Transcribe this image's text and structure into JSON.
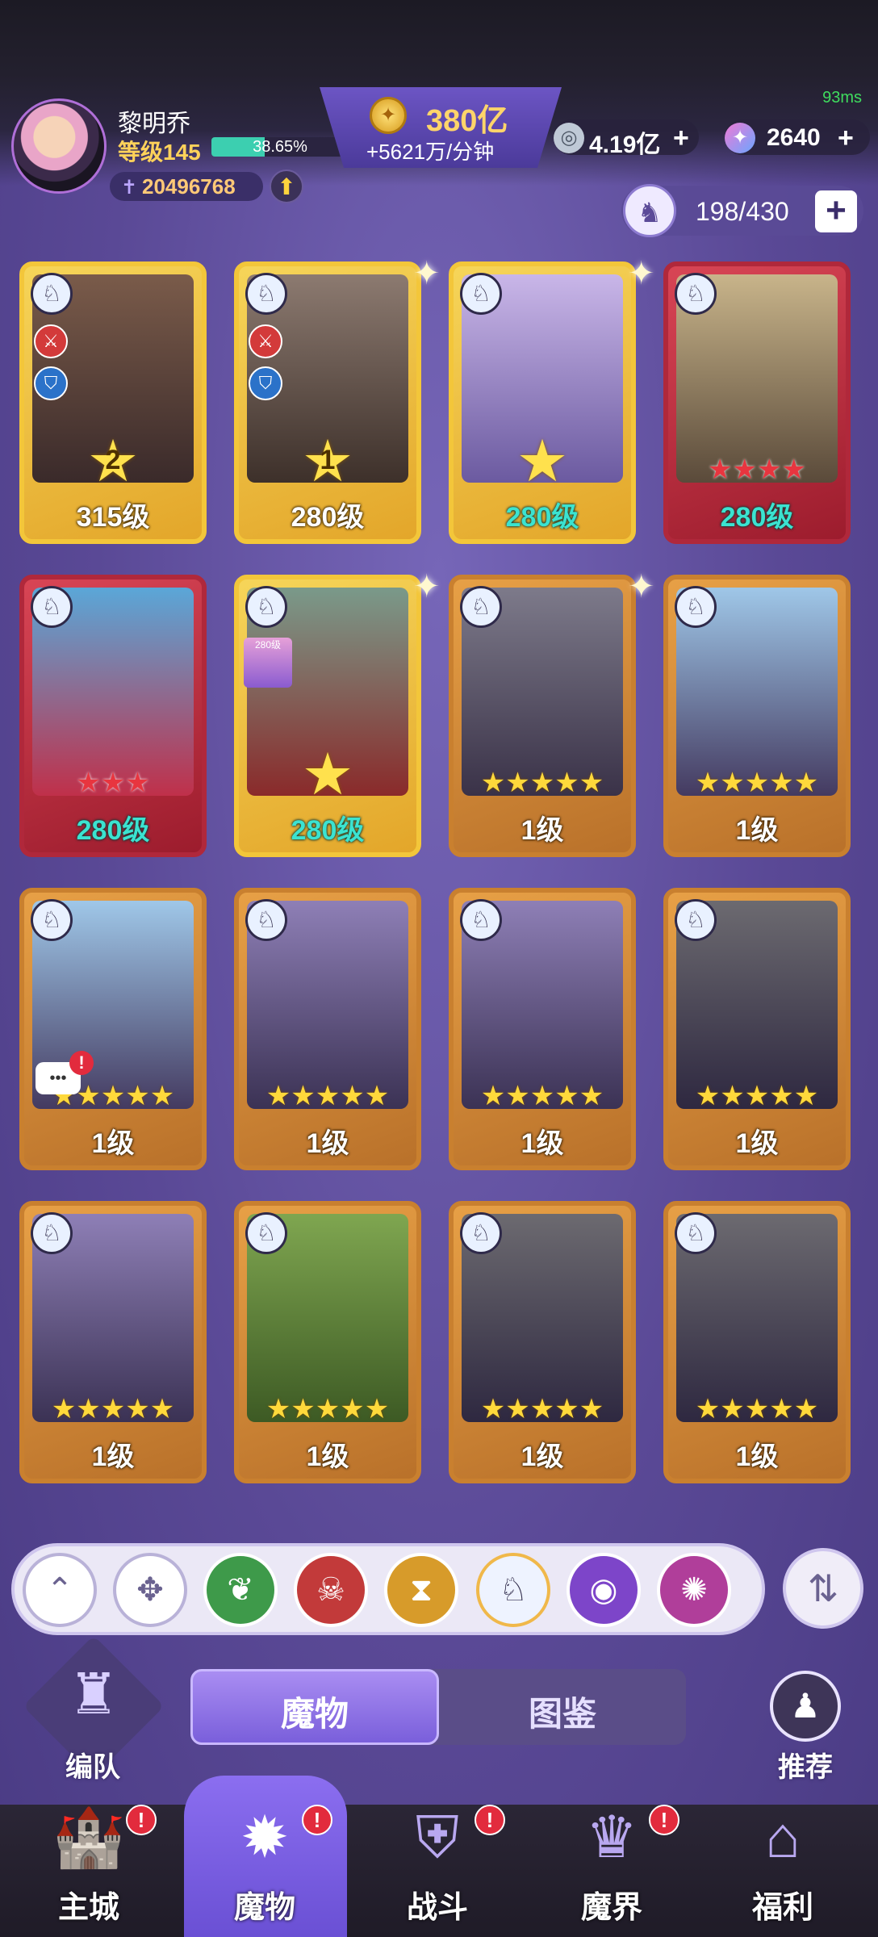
{
  "status": {
    "ping": "93ms"
  },
  "player": {
    "name": "黎明乔",
    "level": "等级145",
    "xp_percent": "38.65%",
    "xp_fraction": 0.3865,
    "power": "20496768"
  },
  "gold": {
    "amount": "380亿",
    "rate": "+5621万/分钟"
  },
  "currencies": [
    {
      "value": "4.19亿",
      "icon": "silver-coin-icon"
    },
    {
      "value": "2640",
      "icon": "star-gem-icon"
    }
  ],
  "roster": {
    "capacity": "198/430"
  },
  "cards": [
    {
      "level": "315级",
      "rank": "2",
      "frame": "gold"
    },
    {
      "level": "280级",
      "rank": "1",
      "frame": "gold"
    },
    {
      "level": "280级",
      "rank": "",
      "frame": "gold"
    },
    {
      "level": "280级",
      "stars": 4,
      "frame": "red"
    },
    {
      "level": "280级",
      "stars": 3,
      "frame": "red"
    },
    {
      "level": "280级",
      "rank": "",
      "frame": "gold",
      "mini_label": "280级"
    },
    {
      "level": "1级",
      "stars": 5,
      "frame": "orange"
    },
    {
      "level": "1级",
      "stars": 5,
      "frame": "orange"
    },
    {
      "level": "1级",
      "stars": 5,
      "frame": "orange"
    },
    {
      "level": "1级",
      "stars": 5,
      "frame": "orange"
    },
    {
      "level": "1级",
      "stars": 5,
      "frame": "orange"
    },
    {
      "level": "1级",
      "stars": 5,
      "frame": "orange"
    },
    {
      "level": "1级",
      "stars": 5,
      "frame": "orange"
    },
    {
      "level": "1级",
      "stars": 5,
      "frame": "orange"
    },
    {
      "level": "1级",
      "stars": 5,
      "frame": "orange"
    },
    {
      "level": "1级",
      "stars": 5,
      "frame": "orange"
    }
  ],
  "filters": [
    {
      "icon": "chevrons-up-icon",
      "color": "#ffffff"
    },
    {
      "icon": "all-factions-icon",
      "color": "#ffffff"
    },
    {
      "icon": "leaf-faction-icon",
      "color": "#3e9a4a"
    },
    {
      "icon": "demon-faction-icon",
      "color": "#c23a3a"
    },
    {
      "icon": "hourglass-faction-icon",
      "color": "#d79b2a"
    },
    {
      "icon": "wolf-faction-icon",
      "color": "#eef3ff",
      "selected": true
    },
    {
      "icon": "eye-faction-icon",
      "color": "#7d45c9"
    },
    {
      "icon": "swirl-faction-icon",
      "color": "#b03e9a"
    }
  ],
  "tabs": {
    "team": "编队",
    "monsters": "魔物",
    "codex": "图鉴",
    "recommend": "推荐"
  },
  "nav": [
    {
      "label": "主城",
      "icon": "castle-icon",
      "badge": "!"
    },
    {
      "label": "魔物",
      "icon": "flame-icon",
      "badge": "!",
      "active": true
    },
    {
      "label": "战斗",
      "icon": "shield-sword-icon",
      "badge": "!"
    },
    {
      "label": "魔界",
      "icon": "demon-realm-icon",
      "badge": "!"
    },
    {
      "label": "福利",
      "icon": "chest-icon",
      "badge": ""
    }
  ],
  "colors": {
    "accent": "#7a5fdb",
    "gold": "#f3c63a",
    "red": "#b0283b",
    "orange": "#c9802f",
    "level_teal": "#3be3d0"
  }
}
